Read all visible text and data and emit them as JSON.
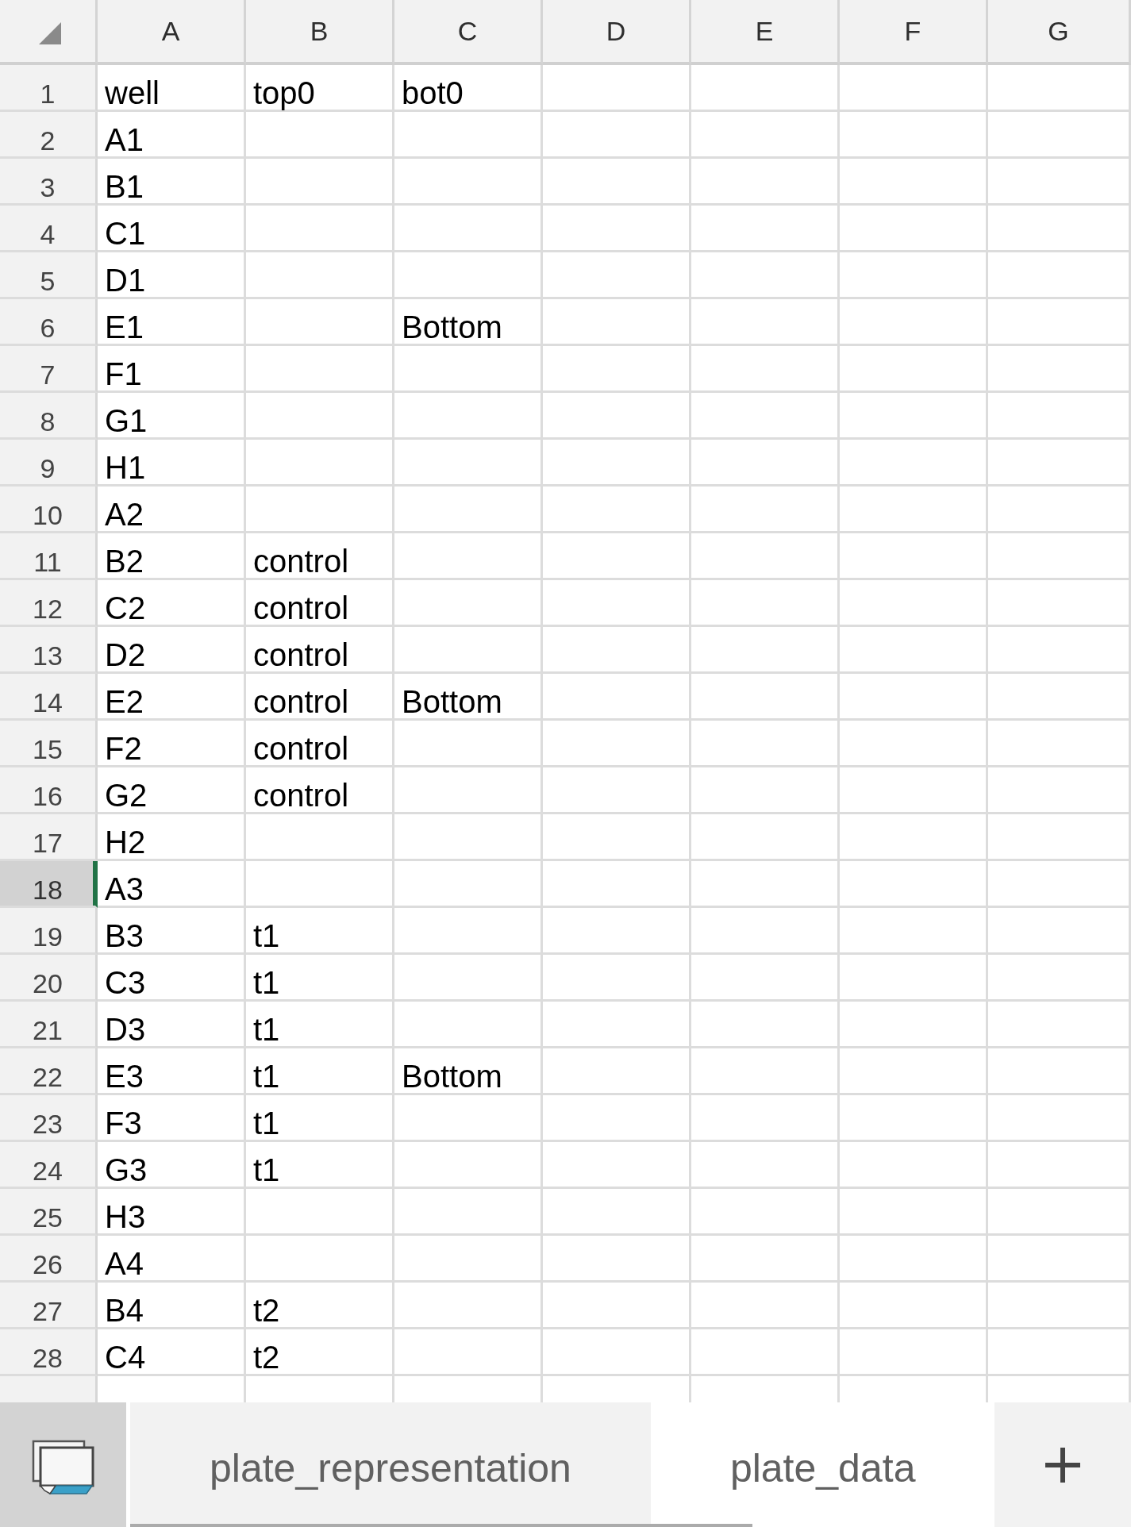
{
  "grid": {
    "columns": [
      "A",
      "B",
      "C",
      "D",
      "E",
      "F",
      "G"
    ],
    "rows": [
      {
        "number": "1",
        "selected": false,
        "cells": [
          "well",
          "top0",
          "bot0"
        ]
      },
      {
        "number": "2",
        "selected": false,
        "cells": [
          "A1"
        ]
      },
      {
        "number": "3",
        "selected": false,
        "cells": [
          "B1"
        ]
      },
      {
        "number": "4",
        "selected": false,
        "cells": [
          "C1"
        ]
      },
      {
        "number": "5",
        "selected": false,
        "cells": [
          "D1"
        ]
      },
      {
        "number": "6",
        "selected": false,
        "cells": [
          "E1",
          null,
          "Bottom"
        ]
      },
      {
        "number": "7",
        "selected": false,
        "cells": [
          "F1"
        ]
      },
      {
        "number": "8",
        "selected": false,
        "cells": [
          "G1"
        ]
      },
      {
        "number": "9",
        "selected": false,
        "cells": [
          "H1"
        ]
      },
      {
        "number": "10",
        "selected": false,
        "cells": [
          "A2"
        ]
      },
      {
        "number": "11",
        "selected": false,
        "cells": [
          "B2",
          "control"
        ]
      },
      {
        "number": "12",
        "selected": false,
        "cells": [
          "C2",
          "control"
        ]
      },
      {
        "number": "13",
        "selected": false,
        "cells": [
          "D2",
          "control"
        ]
      },
      {
        "number": "14",
        "selected": false,
        "cells": [
          "E2",
          "control",
          "Bottom"
        ]
      },
      {
        "number": "15",
        "selected": false,
        "cells": [
          "F2",
          "control"
        ]
      },
      {
        "number": "16",
        "selected": false,
        "cells": [
          "G2",
          "control"
        ]
      },
      {
        "number": "17",
        "selected": false,
        "cells": [
          "H2"
        ]
      },
      {
        "number": "18",
        "selected": true,
        "cells": [
          "A3"
        ]
      },
      {
        "number": "19",
        "selected": false,
        "cells": [
          "B3",
          "t1"
        ]
      },
      {
        "number": "20",
        "selected": false,
        "cells": [
          "C3",
          "t1"
        ]
      },
      {
        "number": "21",
        "selected": false,
        "cells": [
          "D3",
          "t1"
        ]
      },
      {
        "number": "22",
        "selected": false,
        "cells": [
          "E3",
          "t1",
          "Bottom"
        ]
      },
      {
        "number": "23",
        "selected": false,
        "cells": [
          "F3",
          "t1"
        ]
      },
      {
        "number": "24",
        "selected": false,
        "cells": [
          "G3",
          "t1"
        ]
      },
      {
        "number": "25",
        "selected": false,
        "cells": [
          "H3"
        ]
      },
      {
        "number": "26",
        "selected": false,
        "cells": [
          "A4"
        ]
      },
      {
        "number": "27",
        "selected": false,
        "cells": [
          "B4",
          "t2"
        ]
      },
      {
        "number": "28",
        "selected": false,
        "cells": [
          "C4",
          "t2"
        ]
      }
    ]
  },
  "sheet_tabs": [
    {
      "label": "plate_representation",
      "selected": false
    },
    {
      "label": "plate_data",
      "selected": true
    }
  ]
}
